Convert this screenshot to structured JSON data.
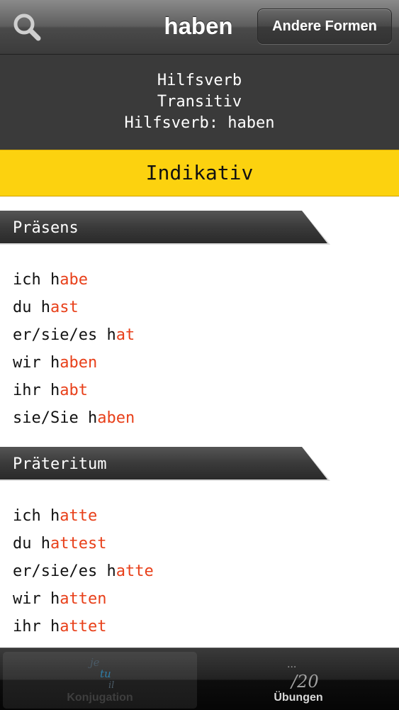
{
  "navbar": {
    "search_icon": "search-icon",
    "title": "haben",
    "other_forms_label": "Andere Formen"
  },
  "info": {
    "line1": "Hilfsverb",
    "line2": "Transitiv",
    "line3": "Hilfsverb: haben"
  },
  "mood": "Indikativ",
  "tenses": [
    {
      "name": "Präsens",
      "rows": [
        {
          "stem": "ich h",
          "ending": "abe"
        },
        {
          "stem": "du h",
          "ending": "ast"
        },
        {
          "stem": "er/sie/es h",
          "ending": "at"
        },
        {
          "stem": "wir h",
          "ending": "aben"
        },
        {
          "stem": "ihr h",
          "ending": "abt"
        },
        {
          "stem": "sie/Sie h",
          "ending": "aben"
        }
      ]
    },
    {
      "name": "Präteritum",
      "rows": [
        {
          "stem": "ich h",
          "ending": "atte"
        },
        {
          "stem": "du h",
          "ending": "attest"
        },
        {
          "stem": "er/sie/es h",
          "ending": "atte"
        },
        {
          "stem": "wir h",
          "ending": "atten"
        },
        {
          "stem": "ihr h",
          "ending": "attet"
        }
      ]
    }
  ],
  "tabbar": {
    "tabs": [
      {
        "label": "Konjugation",
        "icon": "conjugation-icon",
        "icon_text": [
          "je",
          "tu",
          "il"
        ],
        "active": true
      },
      {
        "label": "Übungen",
        "icon": "exercises-icon",
        "icon_text": [
          "...",
          "/20"
        ],
        "active": false
      }
    ]
  },
  "colors": {
    "accent_yellow": "#fcd20f",
    "ending_red": "#e8401a",
    "info_bg": "#3a3a3a"
  }
}
